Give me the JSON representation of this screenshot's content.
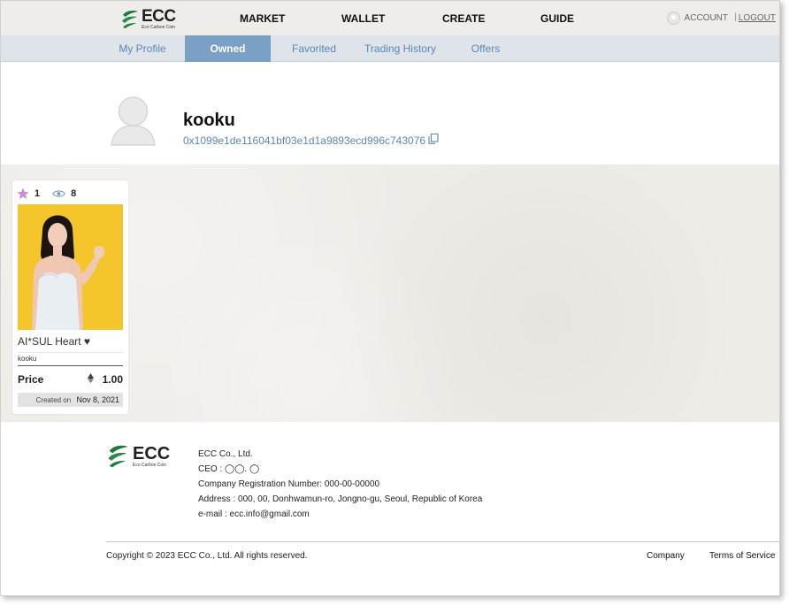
{
  "header": {
    "logo_text": "ECC",
    "logo_subtext": "Eco Carbon Coin",
    "nav": [
      "MARKET",
      "WALLET",
      "CREATE",
      "GUIDE"
    ],
    "account_label": "ACCOUNT",
    "separator": "|",
    "logout_label": "LOGOUT"
  },
  "subnav": {
    "tabs": [
      "My Profile",
      "Owned",
      "Favorited",
      "Trading History",
      "Offers"
    ],
    "active": "Owned"
  },
  "profile": {
    "username": "kooku",
    "wallet_address": "0x1099e1de116041bf03e1d1a9893ecd996c743076"
  },
  "items": [
    {
      "favorites": "1",
      "views": "8",
      "title": "AI*SUL Heart ♥",
      "owner": "kooku",
      "price_label": "Price",
      "price": "1.00",
      "created_label": "Created on",
      "created_date": "Nov 8, 2021"
    }
  ],
  "footer": {
    "logo_text": "ECC",
    "logo_subtext": "Eco Carbon Coin",
    "company": "ECC Co., Ltd.",
    "ceo": "CEO : ◯◯. ◯",
    "registration": "Company Registration Number: 000-00-00000",
    "address": "Address : 000, 00, Donhwamun-ro, Jongno-gu, Seoul, Republic of Korea",
    "email": "e-mail : ecc.info@gmail.com",
    "copyright": "Copyright © 2023 ECC Co., Ltd. All rights reserved.",
    "links": [
      "Company",
      "Terms of Service"
    ]
  },
  "colors": {
    "accent": "#7aa0c6",
    "link": "#5b87b6",
    "brand_green": "#1e7a3c",
    "favorite_star": "#d08ad6"
  },
  "icons": [
    "ecc-leaf-logo",
    "account-icon",
    "user-avatar-icon",
    "copy-icon",
    "star-icon",
    "eye-icon",
    "ethereum-icon"
  ]
}
